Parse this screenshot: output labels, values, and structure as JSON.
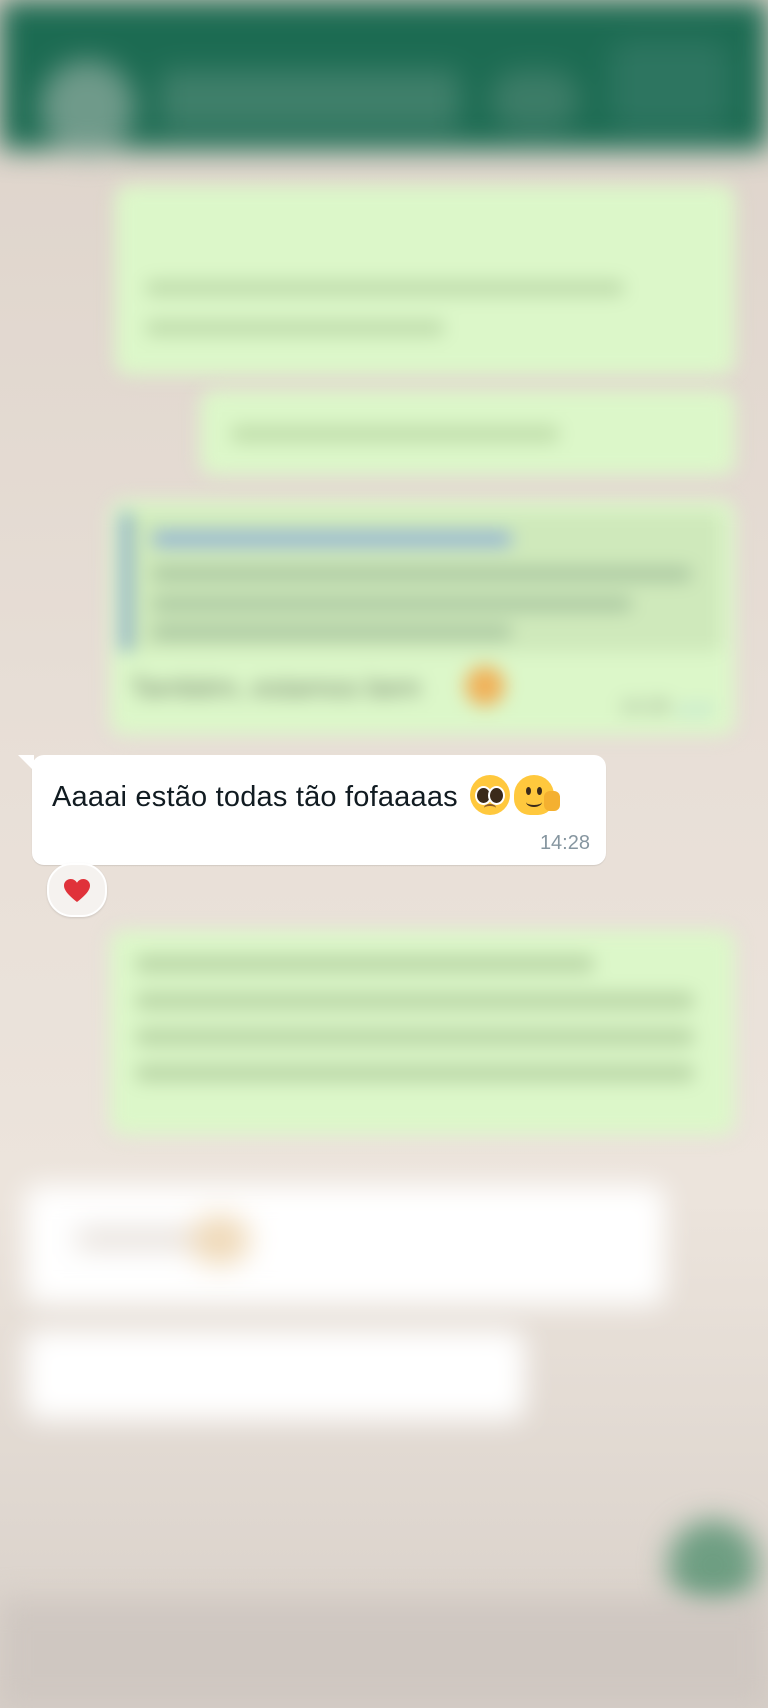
{
  "chat": {
    "focused_message": {
      "text": "Aaaai estão todas tão fofaaaas",
      "emojis": [
        "pleading-face",
        "melting-face"
      ],
      "time": "14:28",
      "reaction": "red-heart"
    },
    "blurred_outgoing_message": {
      "text": "Também, estamos bem",
      "time": "14:26"
    }
  },
  "colors": {
    "header": "#1c6b52",
    "outgoing_bubble": "#dcf7c9",
    "incoming_bubble": "#ffffff",
    "wallpaper": "#e7ddd4",
    "read_ticks": "#6ba6e6",
    "heart": "#e0323a"
  }
}
